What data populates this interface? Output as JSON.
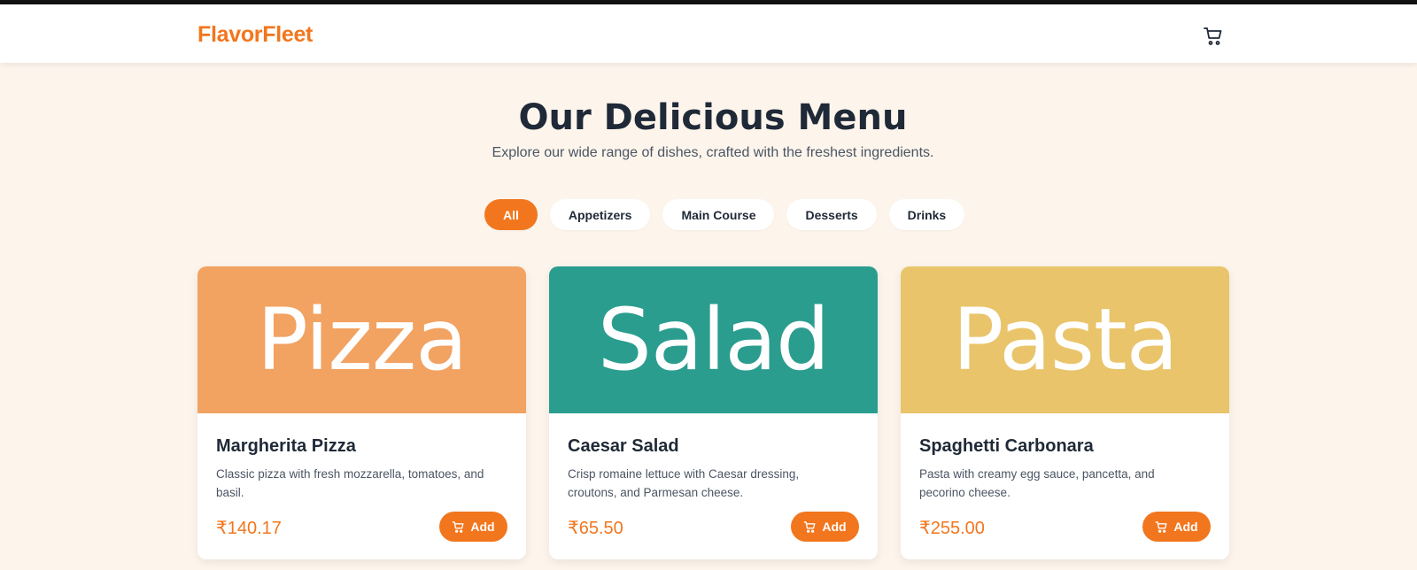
{
  "header": {
    "brand": "FlavorFleet",
    "cart_icon": "cart-icon"
  },
  "hero": {
    "title": "Our Delicious Menu",
    "subtitle": "Explore our wide range of dishes, crafted with the freshest ingredients."
  },
  "filters": [
    {
      "label": "All",
      "active": true
    },
    {
      "label": "Appetizers",
      "active": false
    },
    {
      "label": "Main Course",
      "active": false
    },
    {
      "label": "Desserts",
      "active": false
    },
    {
      "label": "Drinks",
      "active": false
    }
  ],
  "menu": [
    {
      "image_text": "Pizza",
      "image_color": "#f2a261",
      "name": "Margherita Pizza",
      "description": "Classic pizza with fresh mozzarella, tomatoes, and basil.",
      "price": "₹140.17",
      "button_label": "Add"
    },
    {
      "image_text": "Salad",
      "image_color": "#2a9d8f",
      "name": "Caesar Salad",
      "description": "Crisp romaine lettuce with Caesar dressing, croutons, and Parmesan cheese.",
      "price": "₹65.50",
      "button_label": "Add"
    },
    {
      "image_text": "Pasta",
      "image_color": "#e9c46a",
      "name": "Spaghetti Carbonara",
      "description": "Pasta with creamy egg sauce, pancetta, and pecorino cheese.",
      "price": "₹255.00",
      "button_label": "Add"
    }
  ],
  "colors": {
    "accent": "#f2761d",
    "background": "#fdf5ec",
    "text_dark": "#1f2937"
  }
}
